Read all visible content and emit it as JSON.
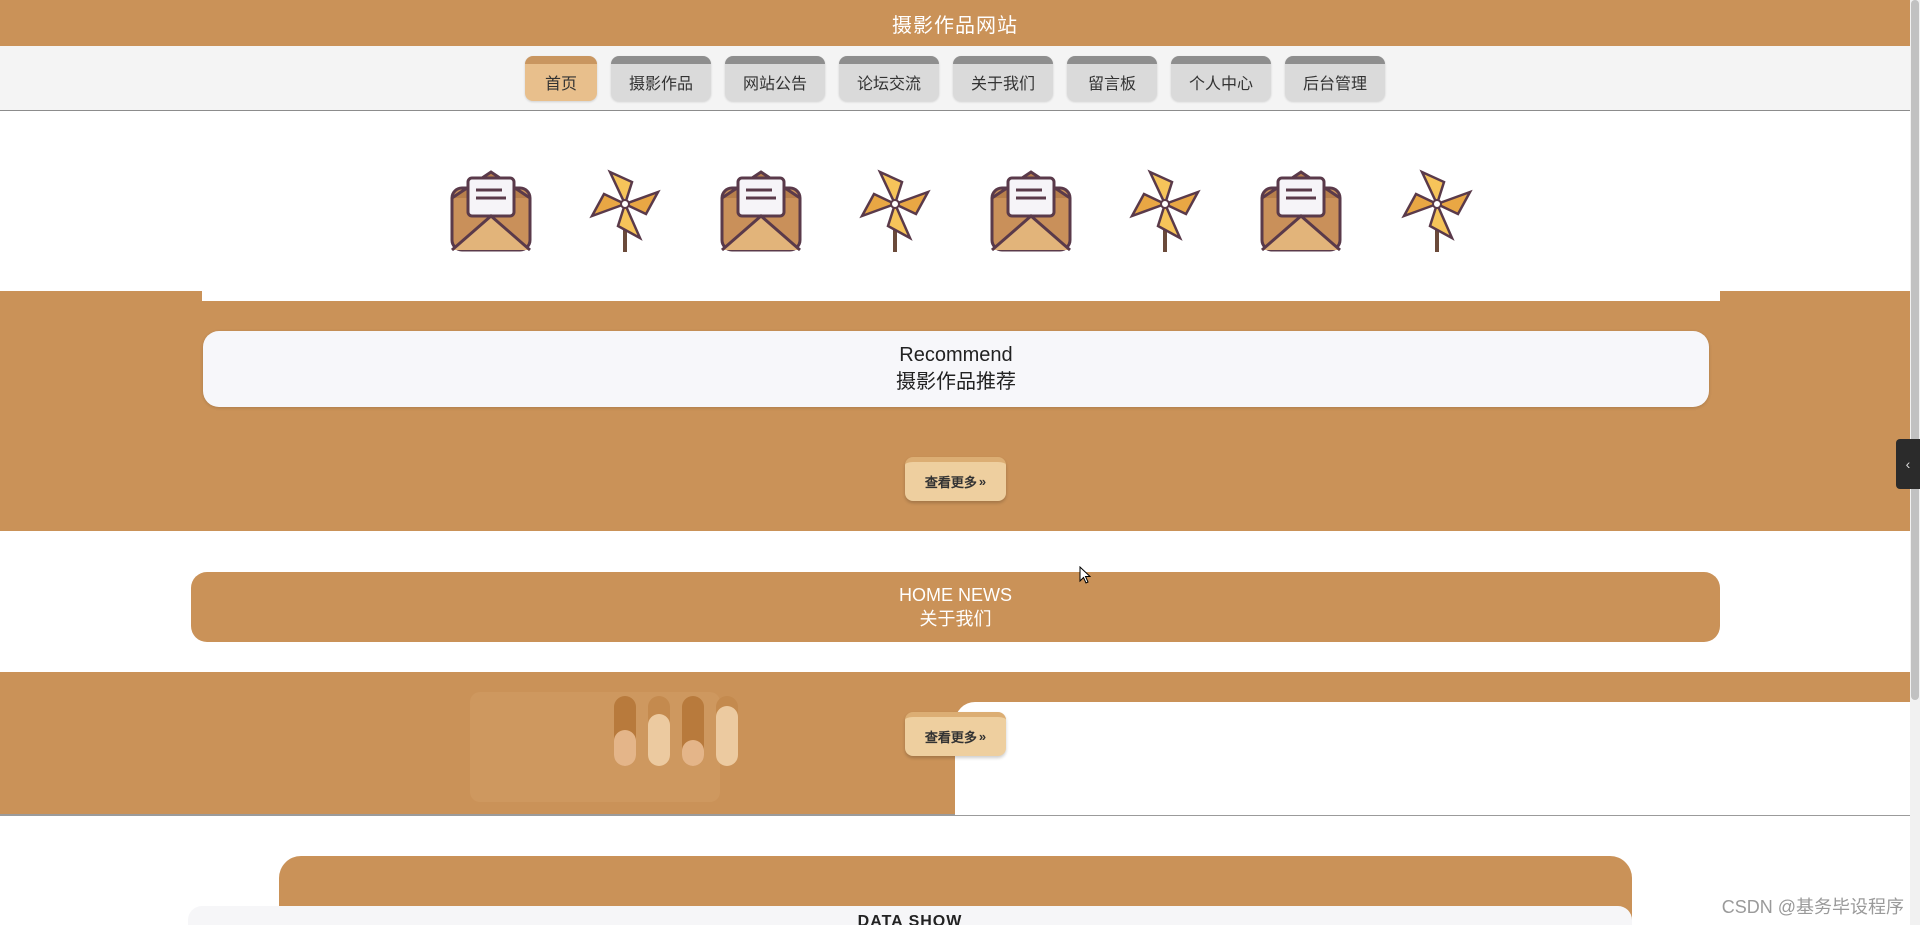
{
  "site": {
    "title": "摄影作品网站"
  },
  "nav": {
    "items": [
      {
        "label": "首页",
        "active": true
      },
      {
        "label": "摄影作品"
      },
      {
        "label": "网站公告"
      },
      {
        "label": "论坛交流"
      },
      {
        "label": "关于我们"
      },
      {
        "label": "留言板"
      },
      {
        "label": "个人中心"
      },
      {
        "label": "后台管理"
      }
    ]
  },
  "icons": [
    "envelope-icon",
    "pinwheel-icon",
    "envelope-icon",
    "pinwheel-icon",
    "envelope-icon",
    "pinwheel-icon",
    "envelope-icon",
    "pinwheel-icon"
  ],
  "recommend": {
    "title_en": "Recommend",
    "title_cn": "摄影作品推荐",
    "more_label": "查看更多",
    "more_arrow": "»"
  },
  "news": {
    "title_en": "HOME NEWS",
    "title_cn": "关于我们",
    "more_label": "查看更多",
    "more_arrow": "»"
  },
  "data_section": {
    "title_en": "DATA SHOW"
  },
  "side_tab": {
    "label": "‹"
  },
  "watermark": {
    "text": "CSDN @基务毕设程序"
  },
  "colors": {
    "primary": "#ca9258",
    "accent": "#eecf9f",
    "nav_bg": "#f4f4f4",
    "nav_active": "#e8bf8c"
  }
}
